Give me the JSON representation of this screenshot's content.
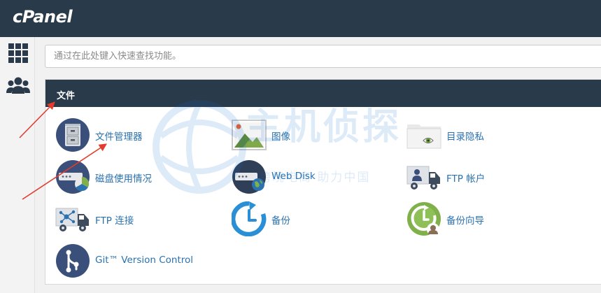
{
  "app": {
    "logo": "cPanel"
  },
  "sidebar": {
    "items": [
      {
        "icon": "grid-icon",
        "color": "#2a3a4a"
      },
      {
        "icon": "users-icon",
        "color": "#2a3a4a"
      }
    ]
  },
  "search": {
    "placeholder": "通过在此处键入快速查找功能。",
    "value": ""
  },
  "section": {
    "title": "文件",
    "items": [
      {
        "label": "文件管理器",
        "icon": "file-cabinet-icon"
      },
      {
        "label": "图像",
        "icon": "image-icon"
      },
      {
        "label": "目录隐私",
        "icon": "folder-eye-icon"
      },
      {
        "label": "磁盘使用情况",
        "icon": "disk-usage-icon"
      },
      {
        "label": "Web Disk",
        "icon": "web-disk-icon"
      },
      {
        "label": "FTP 帐户",
        "icon": "ftp-account-icon"
      },
      {
        "label": "FTP 连接",
        "icon": "ftp-connection-icon"
      },
      {
        "label": "备份",
        "icon": "backup-icon"
      },
      {
        "label": "备份向导",
        "icon": "backup-wizard-icon"
      },
      {
        "label": "Git™ Version Control",
        "icon": "git-icon"
      }
    ]
  },
  "watermark": {
    "title": "主机侦探",
    "subtitle": "跨境电商  助力中国"
  },
  "colors": {
    "header_bg": "#293a4a",
    "link": "#2a72b0",
    "annotation_arrow": "#e33b2e",
    "content_bg": "#f1f1f1"
  }
}
